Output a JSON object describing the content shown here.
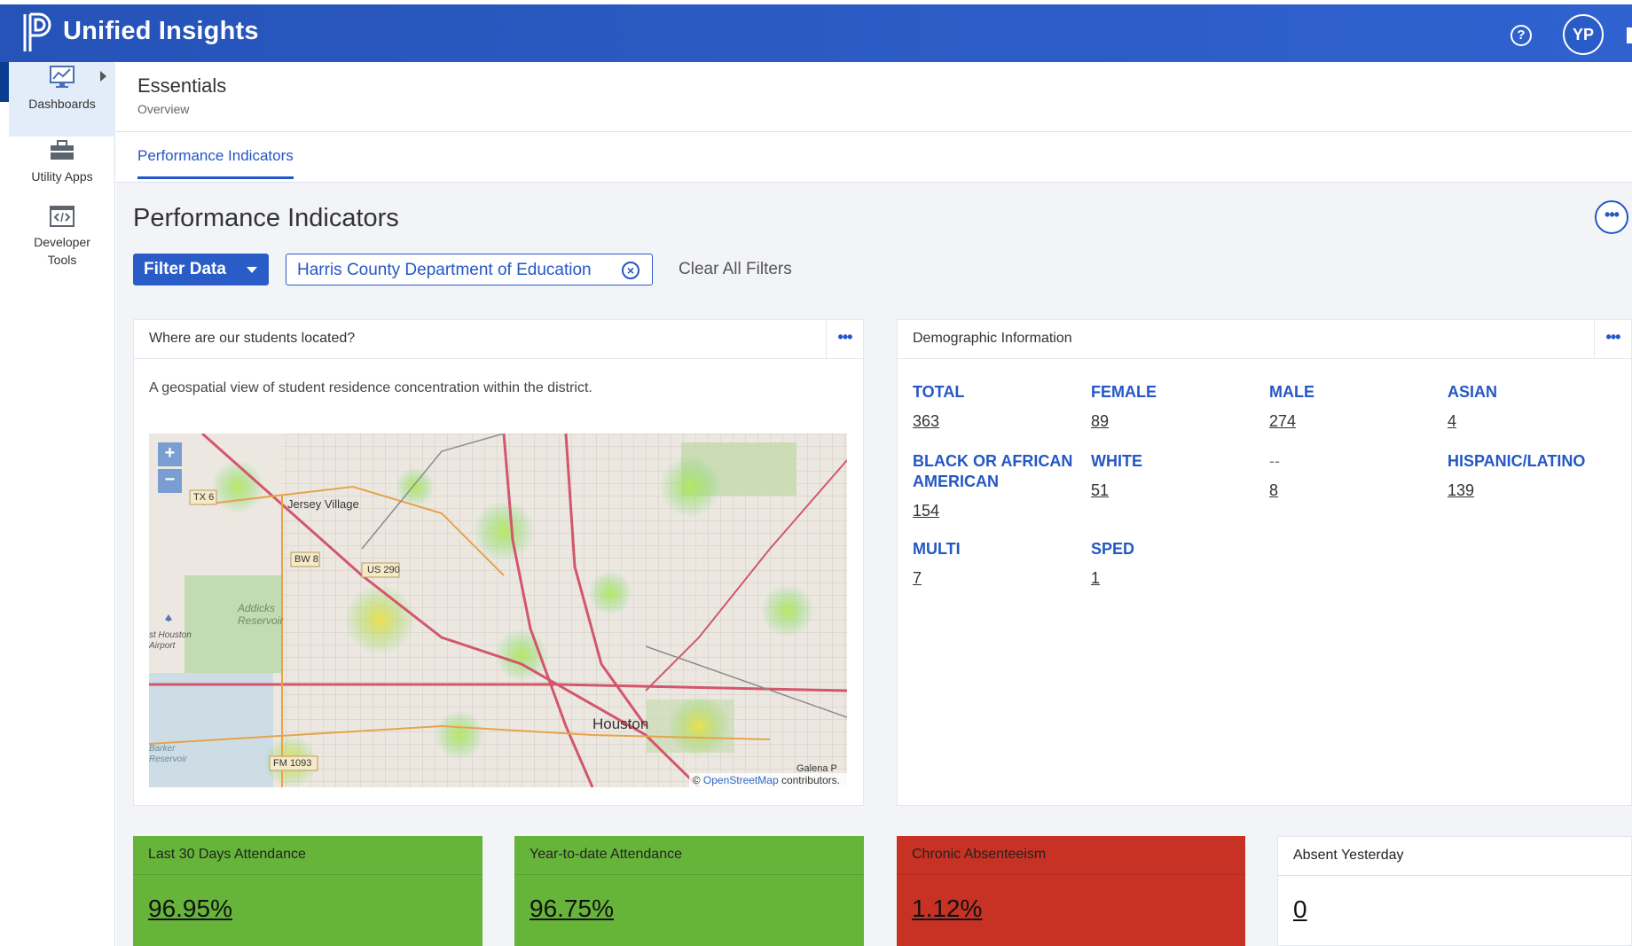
{
  "app": {
    "title": "Unified Insights",
    "help_label": "?",
    "user_initials": "YP"
  },
  "sidebar": {
    "items": [
      {
        "label": "Dashboards",
        "icon": "monitor-chart-icon"
      },
      {
        "label": "Utility Apps",
        "icon": "toolbox-icon"
      },
      {
        "label": "Developer Tools",
        "icon": "code-window-icon"
      }
    ]
  },
  "breadcrumb": {
    "title": "Essentials",
    "subtitle": "Overview"
  },
  "tabs": [
    {
      "label": "Performance Indicators",
      "active": true
    }
  ],
  "page": {
    "title": "Performance Indicators",
    "more_label": "•••"
  },
  "filters": {
    "button_label": "Filter Data",
    "chip_label": "Harris County Department of Education",
    "chip_close": "×",
    "clear_label": "Clear All Filters"
  },
  "map_card": {
    "title": "Where are our students located?",
    "menu_label": "•••",
    "description": "A geospatial view of student residence concentration within the district.",
    "zoom_in": "+",
    "zoom_out": "−",
    "labels": {
      "jersey": "Jersey Village",
      "tx6": "TX 6",
      "bw8": "BW 8",
      "us290": "US 290",
      "addicks": "Addicks Reservoir",
      "airport": "st Houston Airport",
      "houston": "Houston",
      "fm1093": "FM 1093",
      "barker": "Barker Reservoir",
      "galena": "Galena P"
    },
    "attribution_prefix": "© ",
    "attribution_link": "OpenStreetMap",
    "attribution_suffix": " contributors."
  },
  "demographics": {
    "title": "Demographic Information",
    "menu_label": "•••",
    "items": [
      {
        "label": "TOTAL",
        "value": "363"
      },
      {
        "label": "FEMALE",
        "value": "89"
      },
      {
        "label": "MALE",
        "value": "274"
      },
      {
        "label": "ASIAN",
        "value": "4"
      },
      {
        "label": "BLACK OR AFRICAN AMERICAN",
        "value": "154"
      },
      {
        "label": "WHITE",
        "value": "51"
      },
      {
        "label": "--",
        "value": "8"
      },
      {
        "label": "HISPANIC/LATINO",
        "value": "139"
      },
      {
        "label": "MULTI",
        "value": "7"
      },
      {
        "label": "SPED",
        "value": "1"
      }
    ]
  },
  "tiles": [
    {
      "title": "Last 30 Days Attendance",
      "value": "96.95%",
      "color": "#66b53a"
    },
    {
      "title": "Year-to-date Attendance",
      "value": "96.75%",
      "color": "#66b53a"
    },
    {
      "title": "Chronic Absenteeism",
      "value": "1.12%",
      "color": "#c73224"
    },
    {
      "title": "Absent Yesterday",
      "value": "0",
      "color": "#ffffff"
    }
  ]
}
